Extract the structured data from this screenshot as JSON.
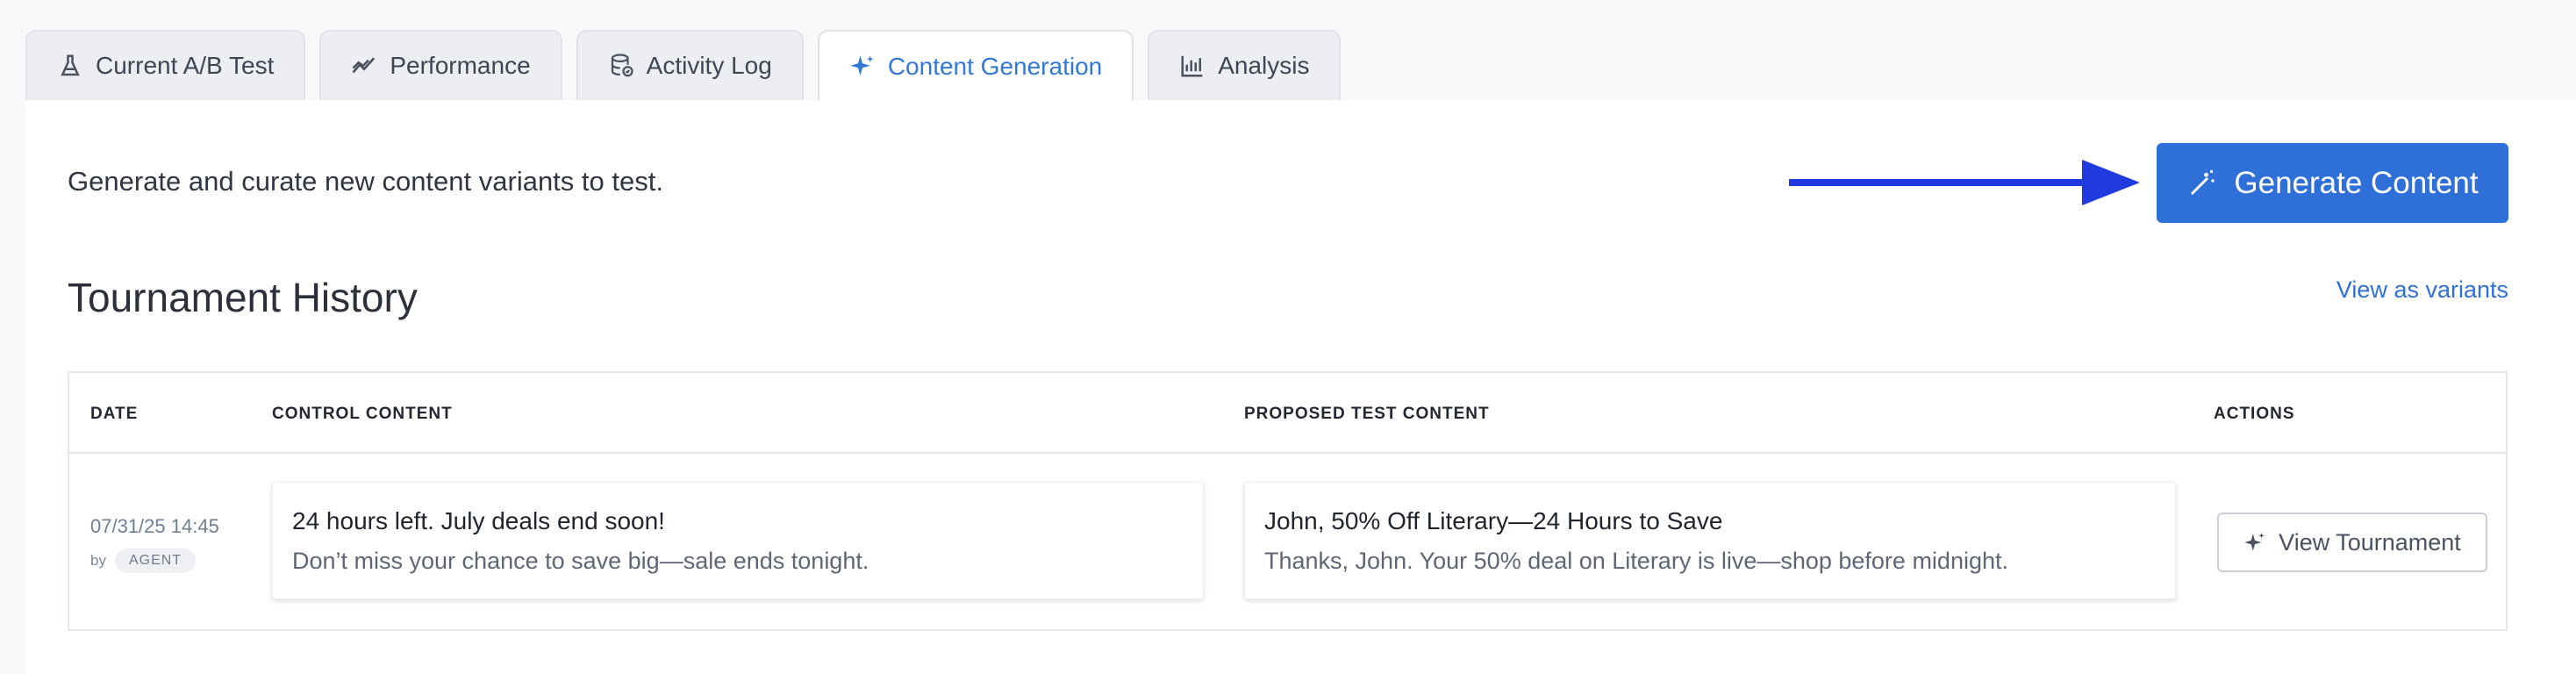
{
  "tabs": [
    {
      "label": "Current A/B Test",
      "icon": "flask-icon",
      "active": false
    },
    {
      "label": "Performance",
      "icon": "trend-icon",
      "active": false
    },
    {
      "label": "Activity Log",
      "icon": "database-icon",
      "active": false
    },
    {
      "label": "Content Generation",
      "icon": "sparkle-icon",
      "active": true
    },
    {
      "label": "Analysis",
      "icon": "bar-chart-icon",
      "active": false
    }
  ],
  "intro_text": "Generate and curate new content variants to test.",
  "generate_button": {
    "label": "Generate Content",
    "icon": "magic-wand-icon"
  },
  "section_title": "Tournament History",
  "view_as_variants": "View as variants",
  "table": {
    "headers": [
      "DATE",
      "CONTROL CONTENT",
      "PROPOSED TEST CONTENT",
      "ACTIONS"
    ],
    "rows": [
      {
        "date": "07/31/25 14:45",
        "by_label": "by",
        "by_badge": "AGENT",
        "control": {
          "title": "24 hours left. July deals end soon!",
          "body": "Don’t miss your chance to save big—sale ends tonight."
        },
        "proposed": {
          "title": "John, 50% Off Literary—24 Hours to Save",
          "body": "Thanks, John. Your 50% deal on Literary is live—shop before midnight."
        },
        "action_label": "View Tournament"
      }
    ]
  },
  "colors": {
    "accent": "#2f6fd8",
    "annotation_arrow": "#1f3be0"
  }
}
